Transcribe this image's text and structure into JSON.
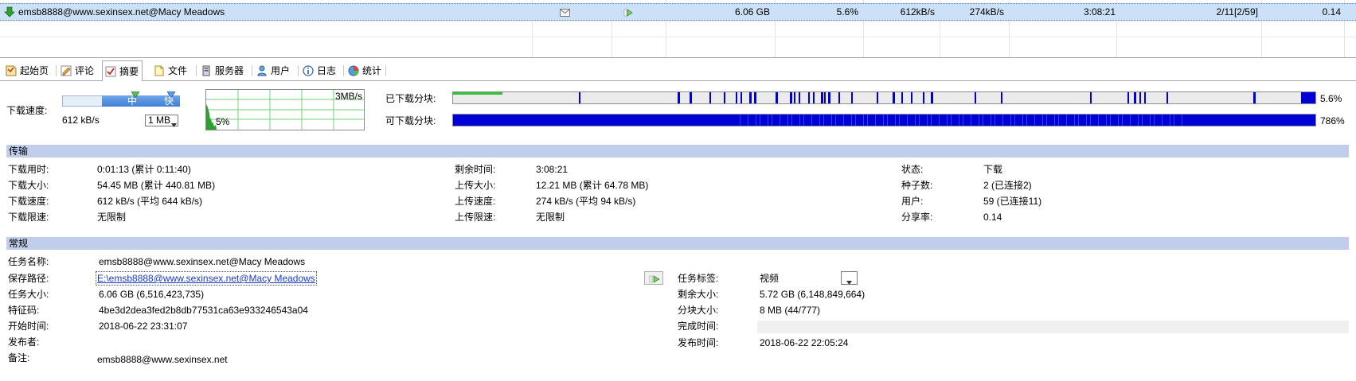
{
  "torrent_list": {
    "name": "emsb8888@www.sexinsex.net@Macy Meadows",
    "size": "6.06 GB",
    "progress": "5.6%",
    "down_speed": "612kB/s",
    "up_speed": "274kB/s",
    "remaining": "3:08:21",
    "peers": "2/11[2/59]",
    "ratio": "0.14"
  },
  "tabs": [
    {
      "label": "起始页",
      "icon": "home-icon"
    },
    {
      "label": "评论",
      "icon": "comment-icon"
    },
    {
      "label": "摘要",
      "icon": "summary-icon",
      "active": true
    },
    {
      "label": "文件",
      "icon": "file-icon"
    },
    {
      "label": "服务器",
      "icon": "server-icon"
    },
    {
      "label": "用户",
      "icon": "user-icon"
    },
    {
      "label": "日志",
      "icon": "info-icon"
    },
    {
      "label": "统计",
      "icon": "stats-icon"
    }
  ],
  "speed_panel": {
    "label": "下载速度:",
    "speed": "612 kB/s",
    "slider_mid": "中",
    "slider_fast": "快",
    "limit_select": "1 MB",
    "graph_max": "3MB/s",
    "graph_pct": "5%"
  },
  "chunks": {
    "downloaded_label": "已下载分块:",
    "downloaded_pct": "5.6%",
    "downloaded_fraction": 0.056,
    "available_label": "可下载分块:",
    "available_pct": "786%"
  },
  "transfer": {
    "title": "传输",
    "col1": [
      {
        "label": "下载用时:",
        "value": "0:01:13 (累计 0:11:40)"
      },
      {
        "label": "下载大小:",
        "value": "54.45 MB (累计 440.81 MB)"
      },
      {
        "label": "下载速度:",
        "value": "612 kB/s (平均 644 kB/s)"
      },
      {
        "label": "下载限速:",
        "value": "无限制"
      }
    ],
    "col2": [
      {
        "label": "剩余时间:",
        "value": "3:08:21"
      },
      {
        "label": "上传大小:",
        "value": "12.21 MB (累计 64.78 MB)"
      },
      {
        "label": "上传速度:",
        "value": "274 kB/s (平均 94 kB/s)"
      },
      {
        "label": "上传限速:",
        "value": "无限制"
      }
    ],
    "col3": [
      {
        "label": "状态:",
        "value": "下载"
      },
      {
        "label": "种子数:",
        "value": "2 (已连接2)"
      },
      {
        "label": "用户:",
        "value": "59 (已连接11)"
      },
      {
        "label": "分享率:",
        "value": "0.14"
      }
    ]
  },
  "general": {
    "title": "常规",
    "left": [
      {
        "label": "任务名称:",
        "value": "emsb8888@www.sexinsex.net@Macy Meadows"
      },
      {
        "label": "保存路径:",
        "value": "E:\\emsb8888@www.sexinsex.net@Macy Meadows"
      },
      {
        "label": "任务大小:",
        "value": "6.06 GB (6,516,423,735)"
      },
      {
        "label": "特征码:",
        "value": "4be3d2dea3fed2b8db77531ca63e933246543a04"
      },
      {
        "label": "开始时间:",
        "value": "2018-06-22 23:31:07"
      },
      {
        "label": "发布者:",
        "value": ""
      },
      {
        "label": "备注:",
        "value": "emsb8888@www.sexinsex.net"
      }
    ],
    "right": [
      {
        "label": "任务标签:",
        "value": "视频"
      },
      {
        "label": "剩余大小:",
        "value": "5.72 GB (6,148,849,664)"
      },
      {
        "label": "分块大小:",
        "value": "8 MB (44/777)"
      },
      {
        "label": "完成时间:",
        "value": ""
      },
      {
        "label": "发布时间:",
        "value": "2018-06-22 22:05:24"
      }
    ]
  }
}
